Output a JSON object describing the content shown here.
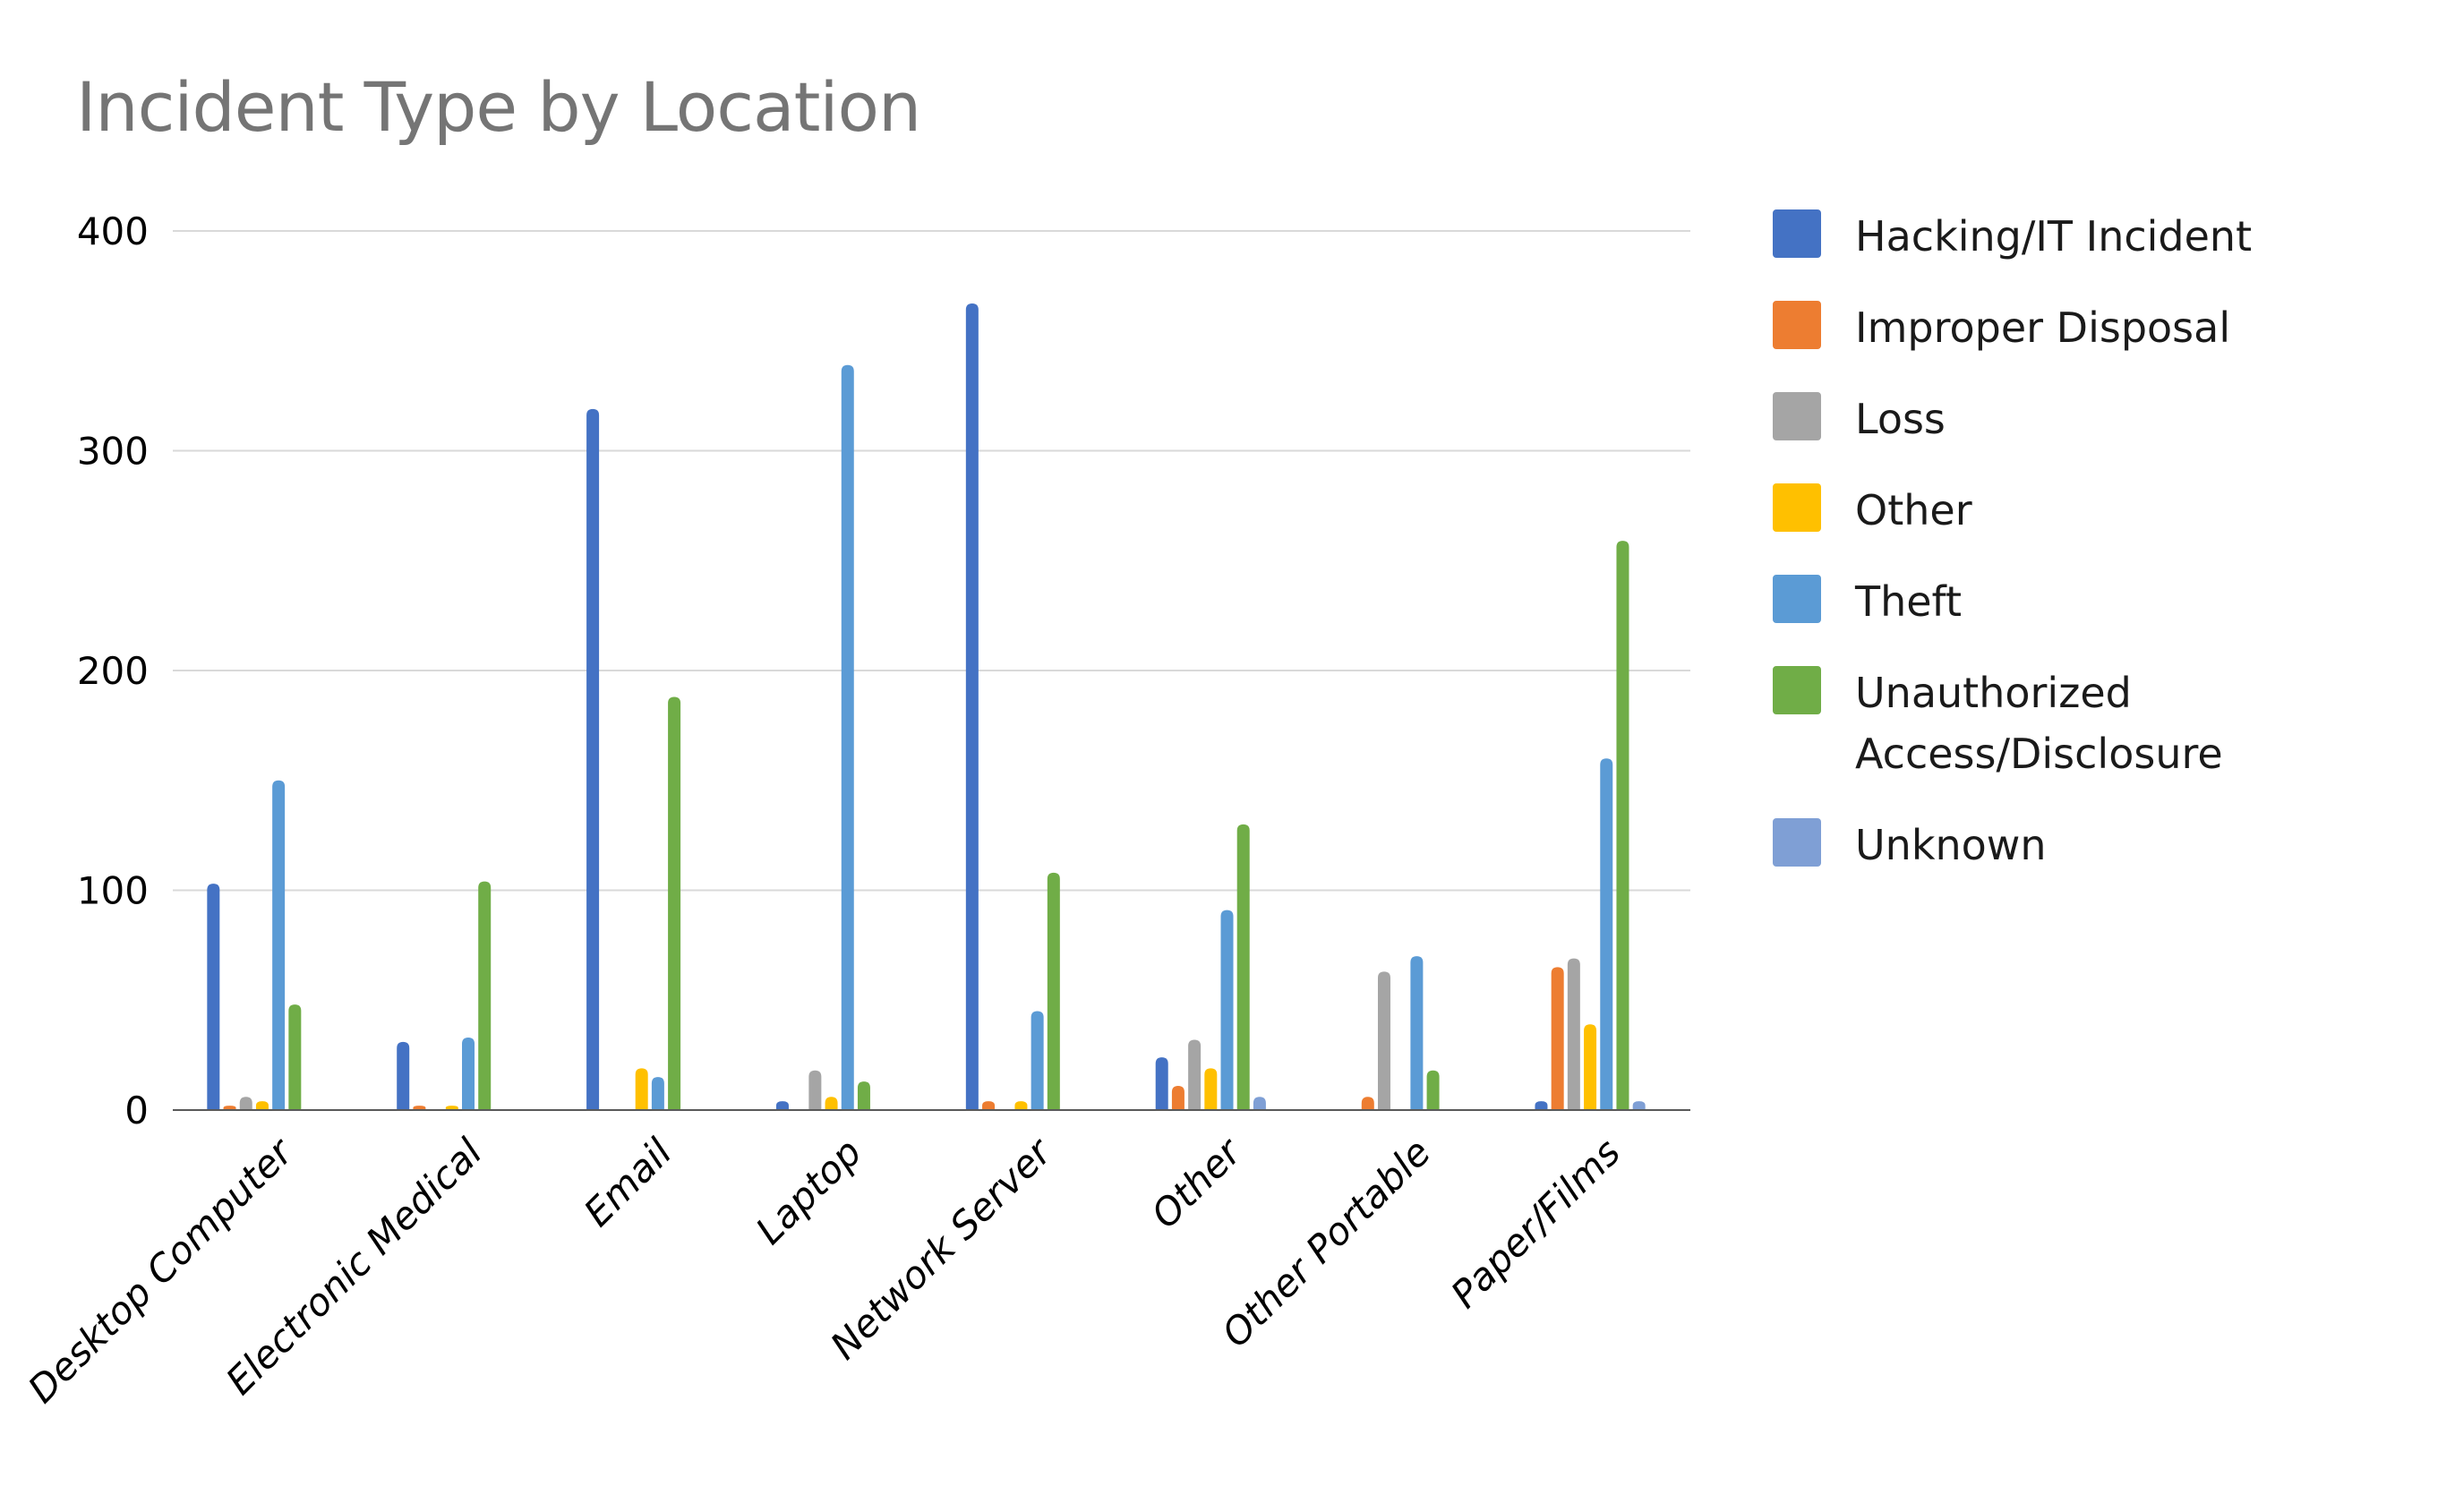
{
  "chart_data": {
    "type": "bar",
    "title": "Incident Type by Location",
    "xlabel": "",
    "ylabel": "",
    "ylim": [
      0,
      400
    ],
    "yticks": [
      0,
      100,
      200,
      300,
      400
    ],
    "grid": true,
    "legend_position": "right",
    "categories": [
      "Desktop Computer",
      "Electronic Medical",
      "Email",
      "Laptop",
      "Network Server",
      "Other",
      "Other Portable",
      "Paper/Films"
    ],
    "series": [
      {
        "name": "Hacking/IT Incident",
        "color": "#4472c4",
        "values": [
          103,
          31,
          319,
          4,
          367,
          24,
          0,
          4
        ]
      },
      {
        "name": "Improper Disposal",
        "color": "#ed7d31",
        "values": [
          2,
          2,
          0,
          0,
          4,
          11,
          6,
          65
        ]
      },
      {
        "name": "Loss",
        "color": "#a5a5a5",
        "values": [
          6,
          0,
          0,
          18,
          0,
          32,
          63,
          69
        ]
      },
      {
        "name": "Other",
        "color": "#ffc000",
        "values": [
          4,
          2,
          19,
          6,
          4,
          19,
          0,
          39
        ]
      },
      {
        "name": "Theft",
        "color": "#5b9bd5",
        "values": [
          150,
          33,
          15,
          339,
          45,
          91,
          70,
          160
        ]
      },
      {
        "name": "Unauthorized Access/Disclosure",
        "color": "#70ad47",
        "values": [
          48,
          104,
          188,
          13,
          108,
          130,
          18,
          259
        ]
      },
      {
        "name": "Unknown",
        "color": "#7f9fd5",
        "values": [
          0,
          0,
          0,
          0,
          0,
          6,
          0,
          4
        ]
      }
    ],
    "legend": [
      {
        "label_lines": [
          "Hacking/IT Incident"
        ]
      },
      {
        "label_lines": [
          "Improper Disposal"
        ]
      },
      {
        "label_lines": [
          "Loss"
        ]
      },
      {
        "label_lines": [
          "Other"
        ]
      },
      {
        "label_lines": [
          "Theft"
        ]
      },
      {
        "label_lines": [
          "Unauthorized",
          "Access/Disclosure"
        ]
      },
      {
        "label_lines": [
          "Unknown"
        ]
      }
    ]
  }
}
